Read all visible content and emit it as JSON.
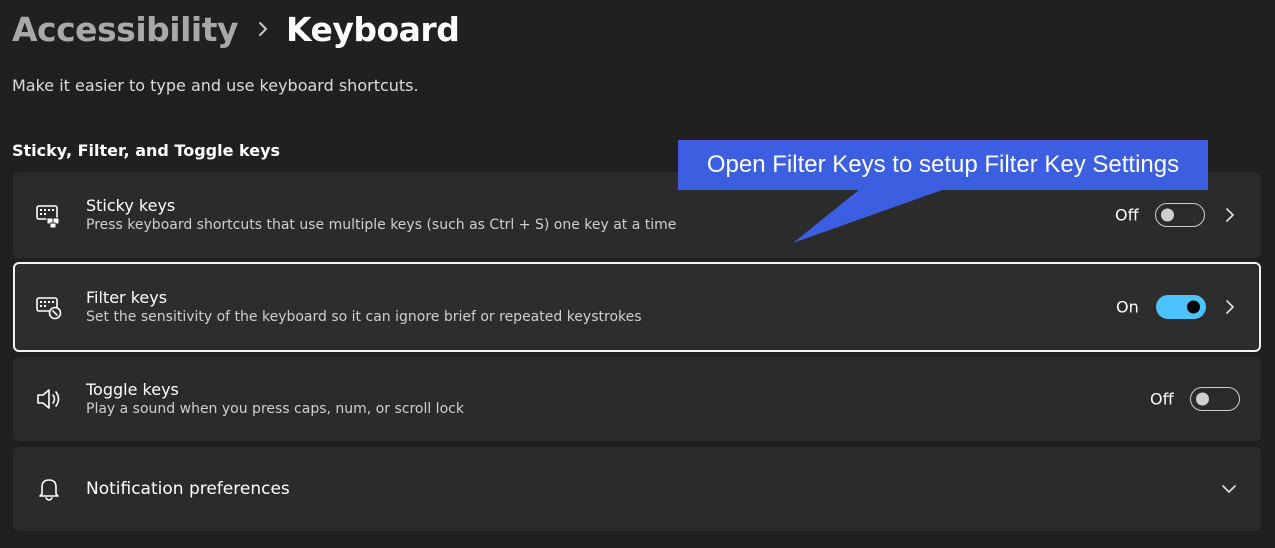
{
  "breadcrumb": {
    "parent": "Accessibility",
    "current": "Keyboard"
  },
  "page_description": "Make it easier to type and use keyboard shortcuts.",
  "section": {
    "title": "Sticky, Filter, and Toggle keys"
  },
  "settings": [
    {
      "title": "Sticky keys",
      "subtitle": "Press keyboard shortcuts that use multiple keys (such as Ctrl + S) one key at a time",
      "state_label": "Off",
      "icon": "sticky-keys-icon"
    },
    {
      "title": "Filter keys",
      "subtitle": "Set the sensitivity of the keyboard so it can ignore brief or repeated keystrokes",
      "state_label": "On",
      "icon": "filter-keys-icon"
    },
    {
      "title": "Toggle keys",
      "subtitle": "Play a sound when you press caps, num, or scroll lock",
      "state_label": "Off",
      "icon": "speaker-icon"
    }
  ],
  "notification": {
    "title": "Notification preferences",
    "icon": "bell-icon"
  },
  "callout": {
    "text": "Open Filter Keys to setup Filter Key Settings"
  },
  "colors": {
    "background": "#202020",
    "card": "#2b2b2b",
    "accent": "#4cc2ff",
    "callout": "#3b5fe0"
  }
}
